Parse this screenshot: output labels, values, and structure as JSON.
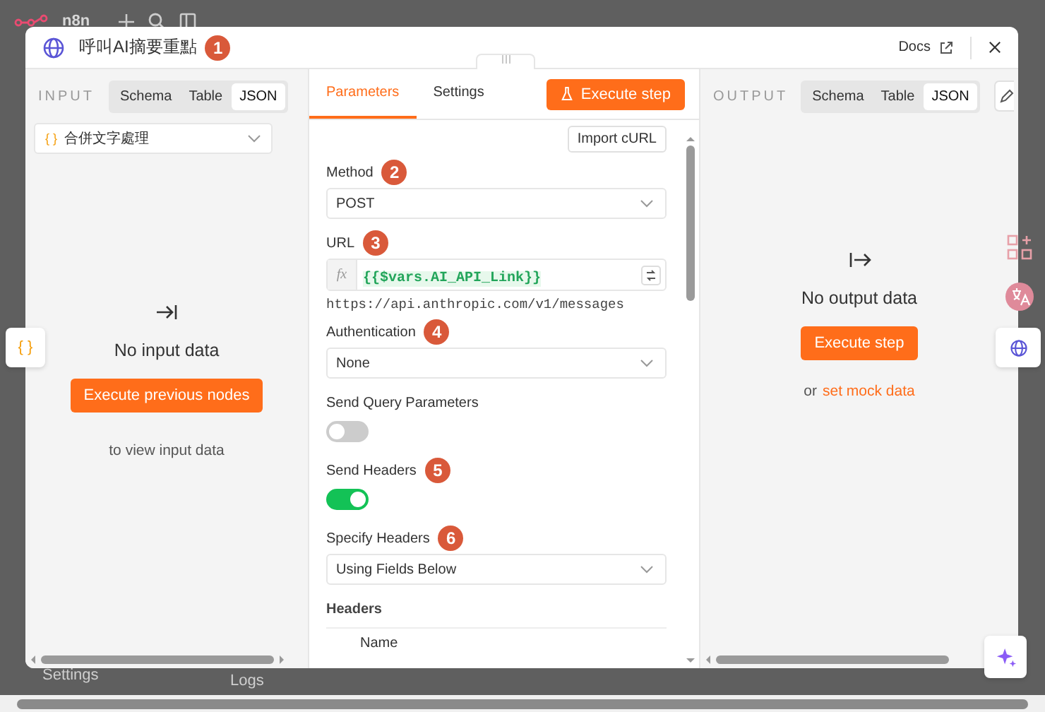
{
  "app": {
    "logo": "n8n",
    "settings": "Settings",
    "logs": "Logs"
  },
  "modal": {
    "title": "呼叫AI摘要重點",
    "badge": "1",
    "docs": "Docs"
  },
  "braces_button": "{ }",
  "input": {
    "heading": "INPUT",
    "source_icon": "{ }",
    "view_tabs": [
      {
        "label": "Schema",
        "selected": false
      },
      {
        "label": "Table",
        "selected": false
      },
      {
        "label": "JSON",
        "selected": true
      }
    ],
    "source_node": "合併文字處理",
    "empty_title": "No input data",
    "button": "Execute previous nodes",
    "hint": "to view input data"
  },
  "node": {
    "tabs": [
      {
        "label": "Parameters",
        "selected": true
      },
      {
        "label": "Settings",
        "selected": false
      }
    ],
    "execute": "Execute step",
    "import": "Import cURL",
    "fields": [
      {
        "kind": "select",
        "label": "Method",
        "badge": "2",
        "value": "POST"
      },
      {
        "kind": "expression",
        "label": "URL",
        "badge": "3",
        "prefix": "fx",
        "value": "{{$vars.AI_API_Link}}",
        "resolved": "https://api.anthropic.com/v1/messages"
      },
      {
        "kind": "select",
        "label": "Authentication",
        "badge": "4",
        "value": "None"
      },
      {
        "kind": "toggle",
        "label": "Send Query Parameters",
        "on": false
      },
      {
        "kind": "toggle",
        "label": "Send Headers",
        "badge": "5",
        "on": true
      },
      {
        "kind": "select",
        "label": "Specify Headers",
        "badge": "6",
        "value": "Using Fields Below"
      },
      {
        "kind": "collection",
        "label": "Headers",
        "column": "Name"
      }
    ]
  },
  "output": {
    "heading": "OUTPUT",
    "view_tabs": [
      {
        "label": "Schema",
        "selected": false
      },
      {
        "label": "Table",
        "selected": false
      },
      {
        "label": "JSON",
        "selected": true
      }
    ],
    "empty_title": "No output data",
    "button": "Execute step",
    "hint": "or",
    "hint_link": "set mock data"
  }
}
